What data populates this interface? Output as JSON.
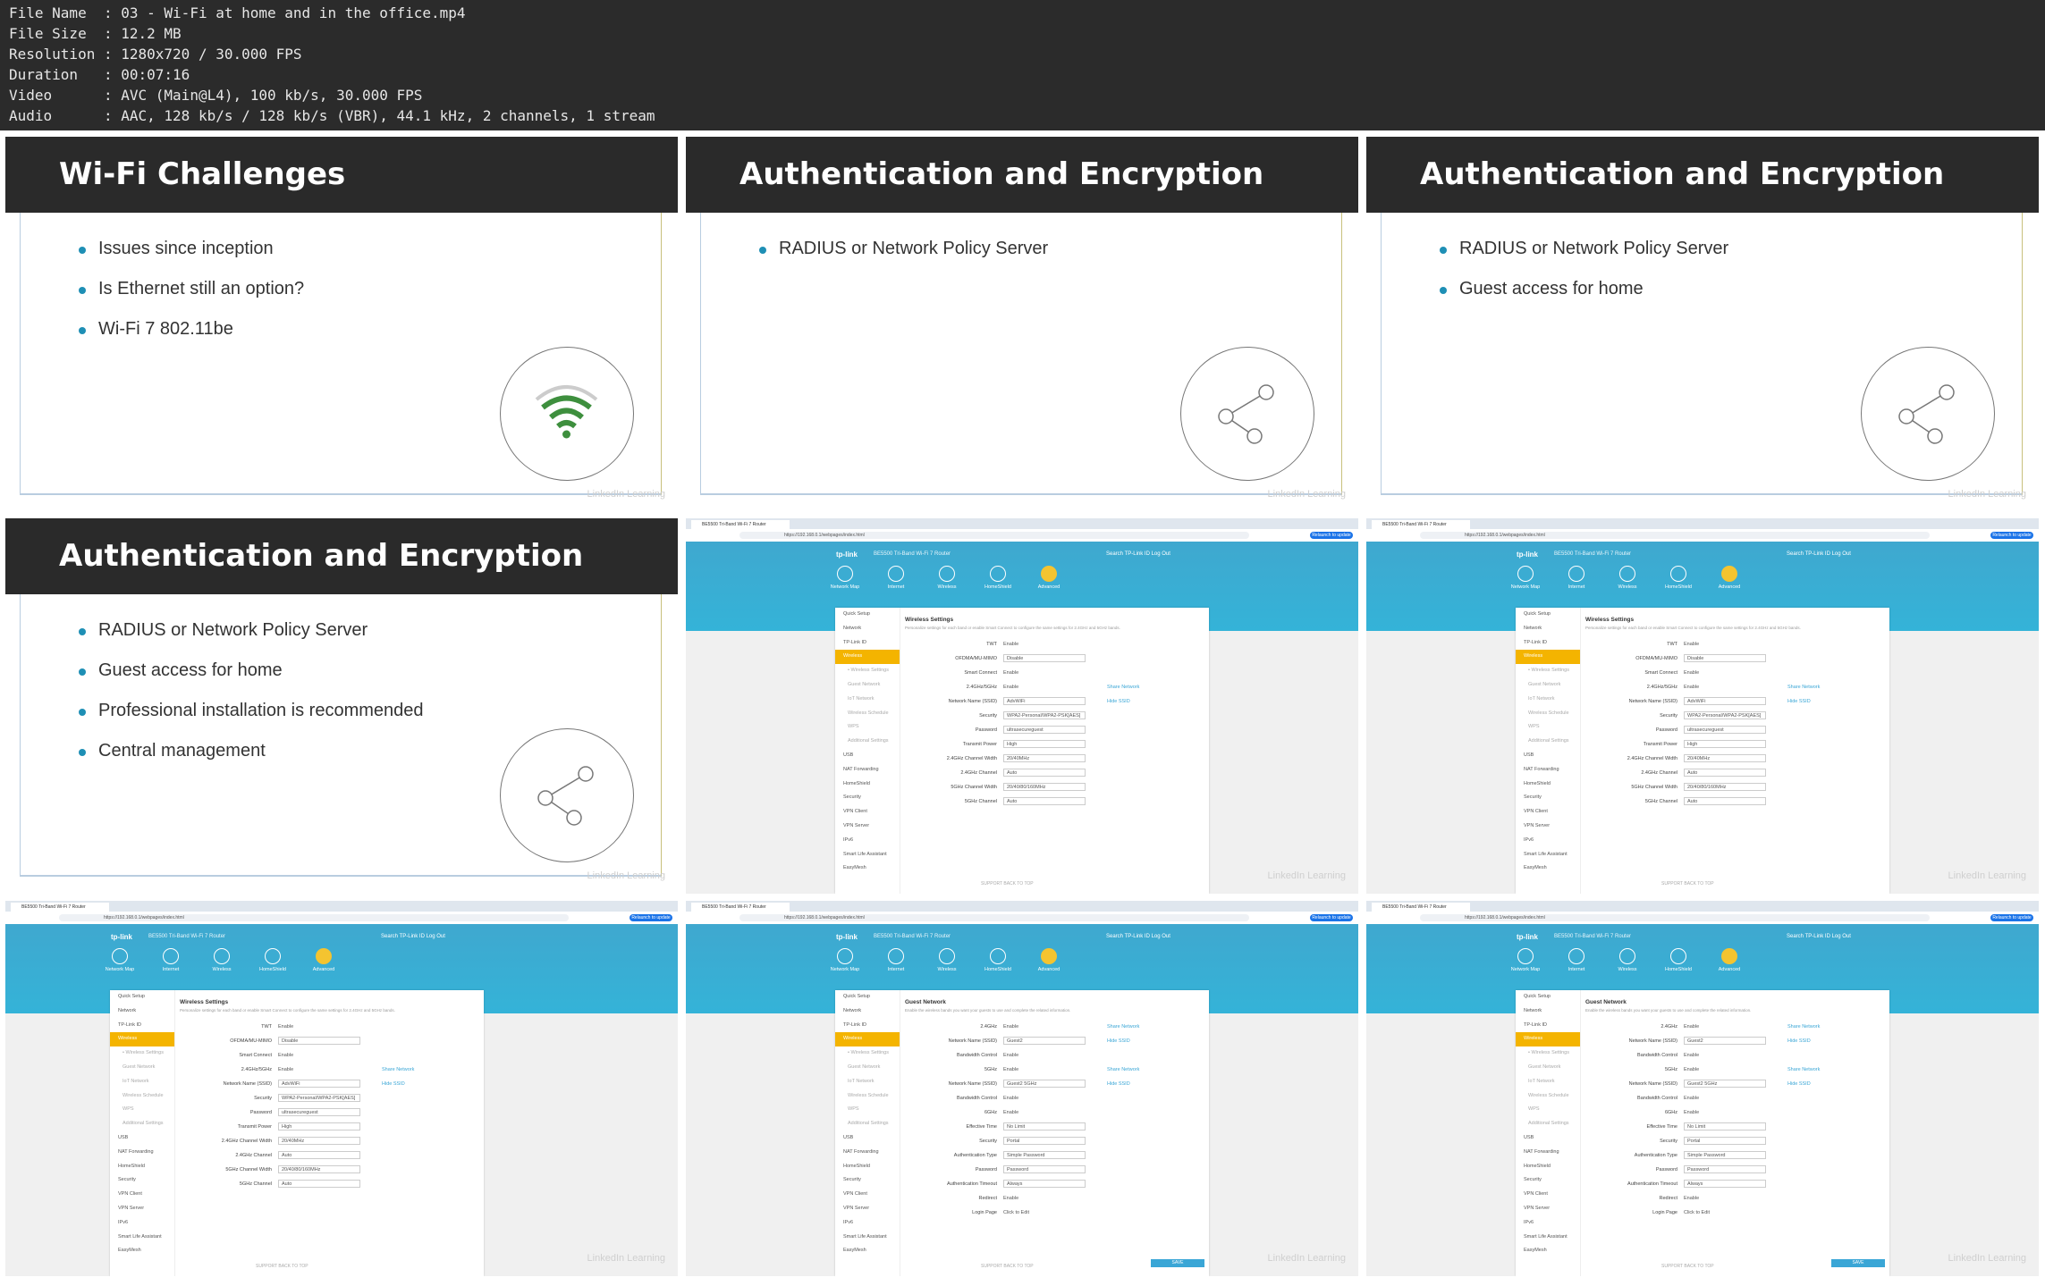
{
  "meta": {
    "rows": [
      {
        "label": "File Name ",
        "sep": ":",
        "value": "03 - Wi-Fi at home and in the office.mp4"
      },
      {
        "label": "File Size ",
        "sep": ":",
        "value": "12.2 MB"
      },
      {
        "label": "Resolution",
        "sep": ":",
        "value": "1280x720 / 30.000 FPS"
      },
      {
        "label": "Duration  ",
        "sep": ":",
        "value": "00:07:16"
      },
      {
        "label": "Video     ",
        "sep": ":",
        "value": "AVC (Main@L4), 100 kb/s, 30.000 FPS"
      },
      {
        "label": "Audio     ",
        "sep": ":",
        "value": "AAC, 128 kb/s / 128 kb/s (VBR), 44.1 kHz, 2 channels, 1 stream"
      }
    ]
  },
  "slides": [
    {
      "title": "Wi-Fi Challenges",
      "bullets": [
        "Issues since inception",
        "Is Ethernet still an option?",
        "Wi-Fi 7 802.11be"
      ],
      "icon": "wifi-icon"
    },
    {
      "title": "Authentication and Encryption",
      "bullets": [
        "RADIUS or Network Policy Server"
      ],
      "icon": "share-icon"
    },
    {
      "title": "Authentication and Encryption",
      "bullets": [
        "RADIUS or Network Policy Server",
        "Guest access for home"
      ],
      "icon": "share-icon"
    },
    {
      "title": "Authentication and Encryption",
      "bullets": [
        "RADIUS or Network Policy Server",
        "Guest access for home",
        "Professional installation is recommended",
        "Central management"
      ],
      "icon": "share-icon"
    }
  ],
  "watermark": "LinkedIn Learning",
  "router": {
    "tab_title": "BE5500 Tri-Band Wi-Fi 7 Router",
    "url": "https://192.168.0.1/webpages/index.html",
    "update_label": "Relaunch to update",
    "logo": "tp-link",
    "model": "BE5500 Tri-Band Wi-Fi 7 Router",
    "links": "Search   TP-Link ID   Log Out",
    "nav": [
      "Network Map",
      "Internet",
      "Wireless",
      "HomeShield",
      "Advanced"
    ],
    "sidebar": [
      "Quick Setup",
      "Network",
      "TP-Link ID",
      "Wireless",
      "• Wireless Settings",
      "Guest Network",
      "IoT Network",
      "Wireless Schedule",
      "WPS",
      "Additional Settings",
      "USB",
      "NAT Forwarding",
      "HomeShield",
      "Security",
      "VPN Client",
      "VPN Server",
      "IPv6",
      "Smart Life Assistant",
      "EasyMesh"
    ],
    "footer": "SUPPORT     BACK TO TOP",
    "save": "SAVE",
    "wireless": {
      "section": "Wireless Settings",
      "desc": "Personalize settings for each band or enable Smart Connect to configure the same settings for 2.4GHz and 5GHz bands.",
      "rows": [
        {
          "k": "TWT",
          "v": "Enable"
        },
        {
          "k": "OFDMA/MU-MIMO",
          "v": "Disable",
          "box": true
        },
        {
          "k": "Smart Connect",
          "v": "Enable"
        },
        {
          "k": "2.4GHz/5GHz",
          "v": "Enable",
          "x": "Share Network"
        },
        {
          "k": "Network Name (SSID)",
          "v": "AdvWiFi",
          "box": true,
          "x": "Hide SSID"
        },
        {
          "k": "Security",
          "v": "WPA2-Personal/WPA2-PSK[AES]",
          "box": true
        },
        {
          "k": "Password",
          "v": "ultrasecureguest",
          "box": true
        },
        {
          "k": "Transmit Power",
          "v": "High",
          "box": true
        },
        {
          "k": "2.4GHz Channel Width",
          "v": "20/40MHz",
          "box": true
        },
        {
          "k": "2.4GHz Channel",
          "v": "Auto",
          "box": true
        },
        {
          "k": "5GHz Channel Width",
          "v": "20/40/80/160MHz",
          "box": true
        },
        {
          "k": "5GHz Channel",
          "v": "Auto",
          "box": true
        }
      ]
    },
    "guest": {
      "section": "Guest Network",
      "desc": "Enable the wireless bands you want your guests to use and complete the related information.",
      "rows": [
        {
          "k": "2.4GHz",
          "v": "Enable",
          "x": "Share Network"
        },
        {
          "k": "Network Name (SSID)",
          "v": "Guest2",
          "box": true,
          "x": "Hide SSID"
        },
        {
          "k": "Bandwidth Control",
          "v": "Enable"
        },
        {
          "k": "5GHz",
          "v": "Enable",
          "x": "Share Network"
        },
        {
          "k": "Network Name (SSID)",
          "v": "Guest2 5GHz",
          "box": true,
          "x": "Hide SSID"
        },
        {
          "k": "Bandwidth Control",
          "v": "Enable"
        },
        {
          "k": "6GHz",
          "v": "Enable"
        },
        {
          "k": "Effective Time",
          "v": "No Limit",
          "box": true
        },
        {
          "k": "Security",
          "v": "Portal",
          "box": true
        },
        {
          "k": "Authentication Type",
          "v": "Simple Password",
          "box": true
        },
        {
          "k": "Password",
          "v": "Password",
          "box": true
        },
        {
          "k": "Authentication Timeout",
          "v": "Always",
          "box": true
        },
        {
          "k": "Redirect",
          "v": "Enable"
        },
        {
          "k": "Login Page",
          "v": "Click to Edit"
        }
      ]
    }
  }
}
